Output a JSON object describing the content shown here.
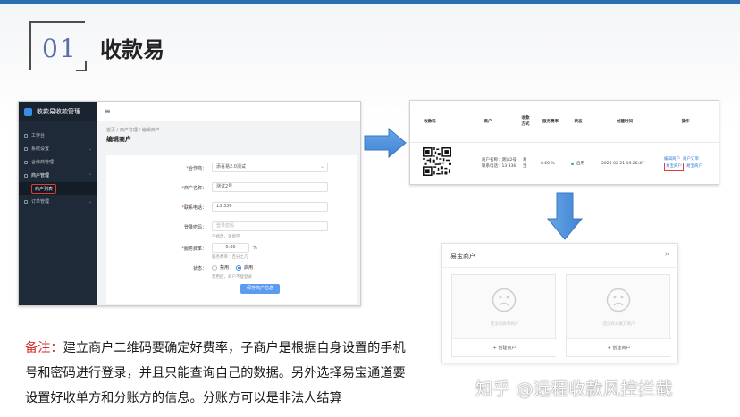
{
  "header": {
    "number": "01",
    "title": "收款易",
    "accent": "#2a6fb0"
  },
  "admin": {
    "brand": "收款易收款管理",
    "menu_icon": "≡",
    "sidebar": [
      {
        "label": "工作台"
      },
      {
        "label": "系统设置"
      },
      {
        "label": "合作商管理"
      },
      {
        "label": "商户管理"
      },
      {
        "label": "订单管理"
      }
    ],
    "sub_item": "商户列表",
    "breadcrumb": "首页 / 商户管理 / 编辑商户",
    "page_title": "编辑商户",
    "form": {
      "partner_label": "合作商：",
      "partner_value": "添喜易2.0测试",
      "name_label": "商户名称：",
      "name_value": "测试2号",
      "phone_label": "联系电话：",
      "phone_value": "13          336",
      "password_label": "登录密码：",
      "password_placeholder": "登录密码",
      "password_hint": "不修改，请留空",
      "rate_label": "服务费率：",
      "rate_value": "0.60",
      "rate_unit": "%",
      "rate_hint": "服务费率：百分之几",
      "status_label": "状态：",
      "status_off": "禁用",
      "status_on": "启用",
      "status_hint": "禁用后，商户不能登录",
      "save_button": "保存商户信息"
    }
  },
  "merchant_table": {
    "headers": [
      "收款码",
      "商户",
      "收款方式",
      "服务费率",
      "状态",
      "创建时间",
      "操作"
    ],
    "row": {
      "merchant_name": "商户名称：测试2号",
      "merchant_phone": "联系电话：13          336",
      "method": "易宝",
      "rate": "0.60 %",
      "status": "启用",
      "created": "2020-02-21 19:26:47",
      "action_edit": "编辑商户",
      "action_yibao": "易宝商户",
      "action_orders": "商户订单",
      "action_yibao2": "易宝商户"
    }
  },
  "dialog": {
    "title": "易宝商户",
    "close": "×",
    "cards": [
      {
        "text": "还没有收单商户",
        "button": "+ 创建商户"
      },
      {
        "text": "还没有分账方商户",
        "button": "+ 创建商户"
      }
    ]
  },
  "note": {
    "label": "备注：",
    "text": "建立商户二维码要确定好费率，子商户是根据自身设置的手机号和密码进行登录，并且只能查询自己的数据。另外选择易宝通道要设置好收单方和分账方的信息。分账方可以是非法人结算"
  },
  "watermark": "知乎 @远程收款风控拦截"
}
